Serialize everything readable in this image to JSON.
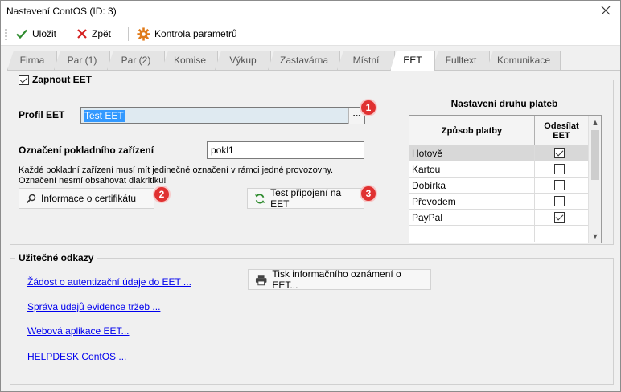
{
  "window": {
    "title": "Nastavení ContOS  (ID: 3)",
    "close_icon": "close-icon"
  },
  "toolbar": {
    "save_label": "Uložit",
    "back_label": "Zpět",
    "check_label": "Kontrola parametrů",
    "colors": {
      "save": "#2e8b2e",
      "back": "#d42020",
      "check": "#e07b1a"
    }
  },
  "tabs": [
    {
      "label": "Firma",
      "active": false
    },
    {
      "label": "Par (1)",
      "active": false
    },
    {
      "label": "Par (2)",
      "active": false
    },
    {
      "label": "Komise",
      "active": false
    },
    {
      "label": "Výkup",
      "active": false
    },
    {
      "label": "Zastavárna",
      "active": false
    },
    {
      "label": "Místní",
      "active": false
    },
    {
      "label": "EET",
      "active": true
    },
    {
      "label": "Fulltext",
      "active": false
    },
    {
      "label": "Komunikace",
      "active": false
    }
  ],
  "eet": {
    "enable_label": "Zapnout EET",
    "enabled": true,
    "profile_label": "Profil EET",
    "profile_value": "Test EET",
    "dots_label": "...",
    "device_label": "Označení pokladního zařízení",
    "device_value": "pokl1",
    "note_line1": "Každé pokladní zařízení musí mít jedinečné označení v rámci jedné provozovny.",
    "note_line2": "Označení nesmí obsahovat diakritiku!",
    "cert_button": "Informace o certifikátu",
    "test_button": "Test připojení na EET",
    "badges": [
      "1",
      "2",
      "3"
    ],
    "badge_color": "#e03131"
  },
  "payments": {
    "title": "Nastavení druhu plateb",
    "col_method": "Způsob platby",
    "col_send_line1": "Odesílat",
    "col_send_line2": "EET",
    "rows": [
      {
        "name": "Hotově",
        "send": true,
        "selected": true
      },
      {
        "name": "Kartou",
        "send": false,
        "selected": false
      },
      {
        "name": "Dobírka",
        "send": false,
        "selected": false
      },
      {
        "name": "Převodem",
        "send": false,
        "selected": false
      },
      {
        "name": "PayPal",
        "send": true,
        "selected": false
      }
    ]
  },
  "links": {
    "title": "Užitečné odkazy",
    "items": [
      "Žádost o autentizační údaje do EET ...",
      "Správa údajů evidence tržeb ...",
      "Webová aplikace EET...",
      "HELPDESK ContOS ..."
    ],
    "print_button": "Tisk informačního oznámení o EET..."
  }
}
